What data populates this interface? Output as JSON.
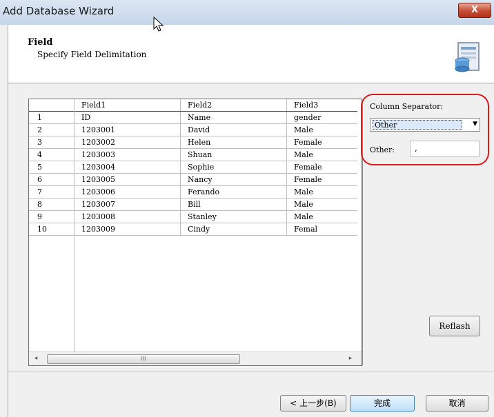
{
  "window": {
    "title": "Add Database Wizard",
    "close_label": "X"
  },
  "header": {
    "title": "Field",
    "subtitle": "Specify Field Delimitation"
  },
  "grid": {
    "columns": [
      "Field1",
      "Field2",
      "Field3"
    ],
    "rows": [
      {
        "num": "1",
        "cells": [
          "ID",
          "Name",
          "gender"
        ]
      },
      {
        "num": "2",
        "cells": [
          "1203001",
          "David",
          "Male"
        ]
      },
      {
        "num": "3",
        "cells": [
          "1203002",
          "Helen",
          "Female"
        ]
      },
      {
        "num": "4",
        "cells": [
          "1203003",
          "Shuan",
          "Male"
        ]
      },
      {
        "num": "5",
        "cells": [
          "1203004",
          "Sophie",
          "Female"
        ]
      },
      {
        "num": "6",
        "cells": [
          "1203005",
          "Nancy",
          "Female"
        ]
      },
      {
        "num": "7",
        "cells": [
          "1203006",
          "Ferando",
          "Male"
        ]
      },
      {
        "num": "8",
        "cells": [
          "1203007",
          "Bill",
          "Male"
        ]
      },
      {
        "num": "9",
        "cells": [
          "1203008",
          "Stanley",
          "Male"
        ]
      },
      {
        "num": "10",
        "cells": [
          "1203009",
          "Cindy",
          "Femal"
        ]
      }
    ],
    "scroll_left": "◂",
    "scroll_right": "▸",
    "scroll_grip": "III"
  },
  "separator": {
    "label": "Column Separator:",
    "selected": "Other",
    "arrow": "▼",
    "other_label": "Other:",
    "other_value": ","
  },
  "buttons": {
    "reflash": "Reflash",
    "back": "< 上一步(B)",
    "finish": "完成",
    "cancel": "取消"
  },
  "colors": {
    "highlight": "#e01818",
    "titlebar": "#c6d6ea",
    "finish_button": "#bfe0f8"
  },
  "icons": {
    "cursor": "mouse-cursor-icon",
    "wizard": "database-wizard-icon",
    "close": "close-icon"
  }
}
